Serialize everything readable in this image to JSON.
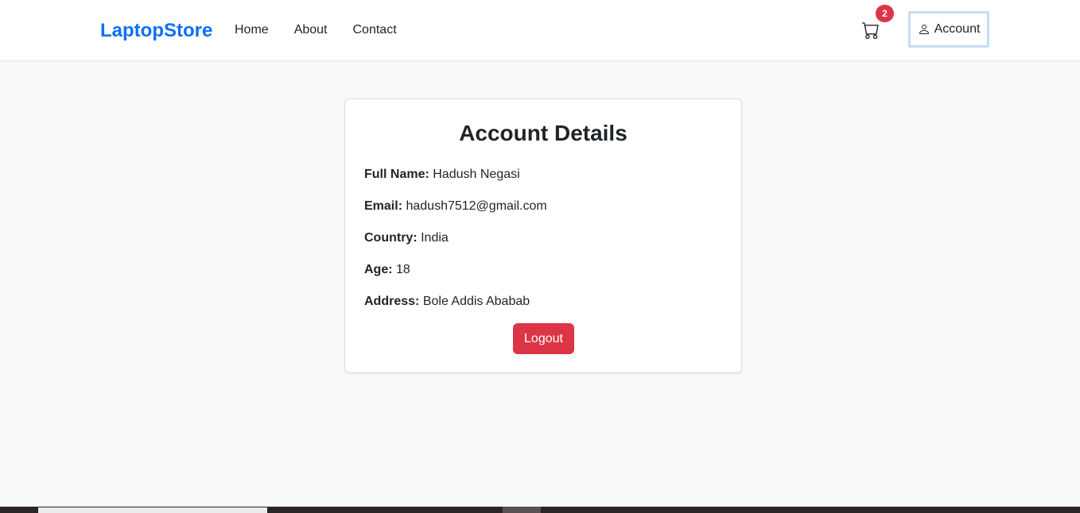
{
  "navbar": {
    "brand": "LaptopStore",
    "links": [
      "Home",
      "About",
      "Contact"
    ],
    "cart_count": "2",
    "account_label": "Account"
  },
  "account": {
    "title": "Account Details",
    "fields": [
      {
        "label": "Full Name:",
        "value": "Hadush Negasi"
      },
      {
        "label": "Email:",
        "value": "hadush7512@gmail.com"
      },
      {
        "label": "Country:",
        "value": "India"
      },
      {
        "label": "Age:",
        "value": "18"
      },
      {
        "label": "Address:",
        "value": "Bole Addis Ababab"
      }
    ],
    "logout_label": "Logout"
  },
  "colors": {
    "brand": "#0d6efd",
    "danger": "#dc3545",
    "background": "#f8f9fa"
  },
  "icons": {
    "cart": "cart-icon",
    "account": "person-icon"
  }
}
